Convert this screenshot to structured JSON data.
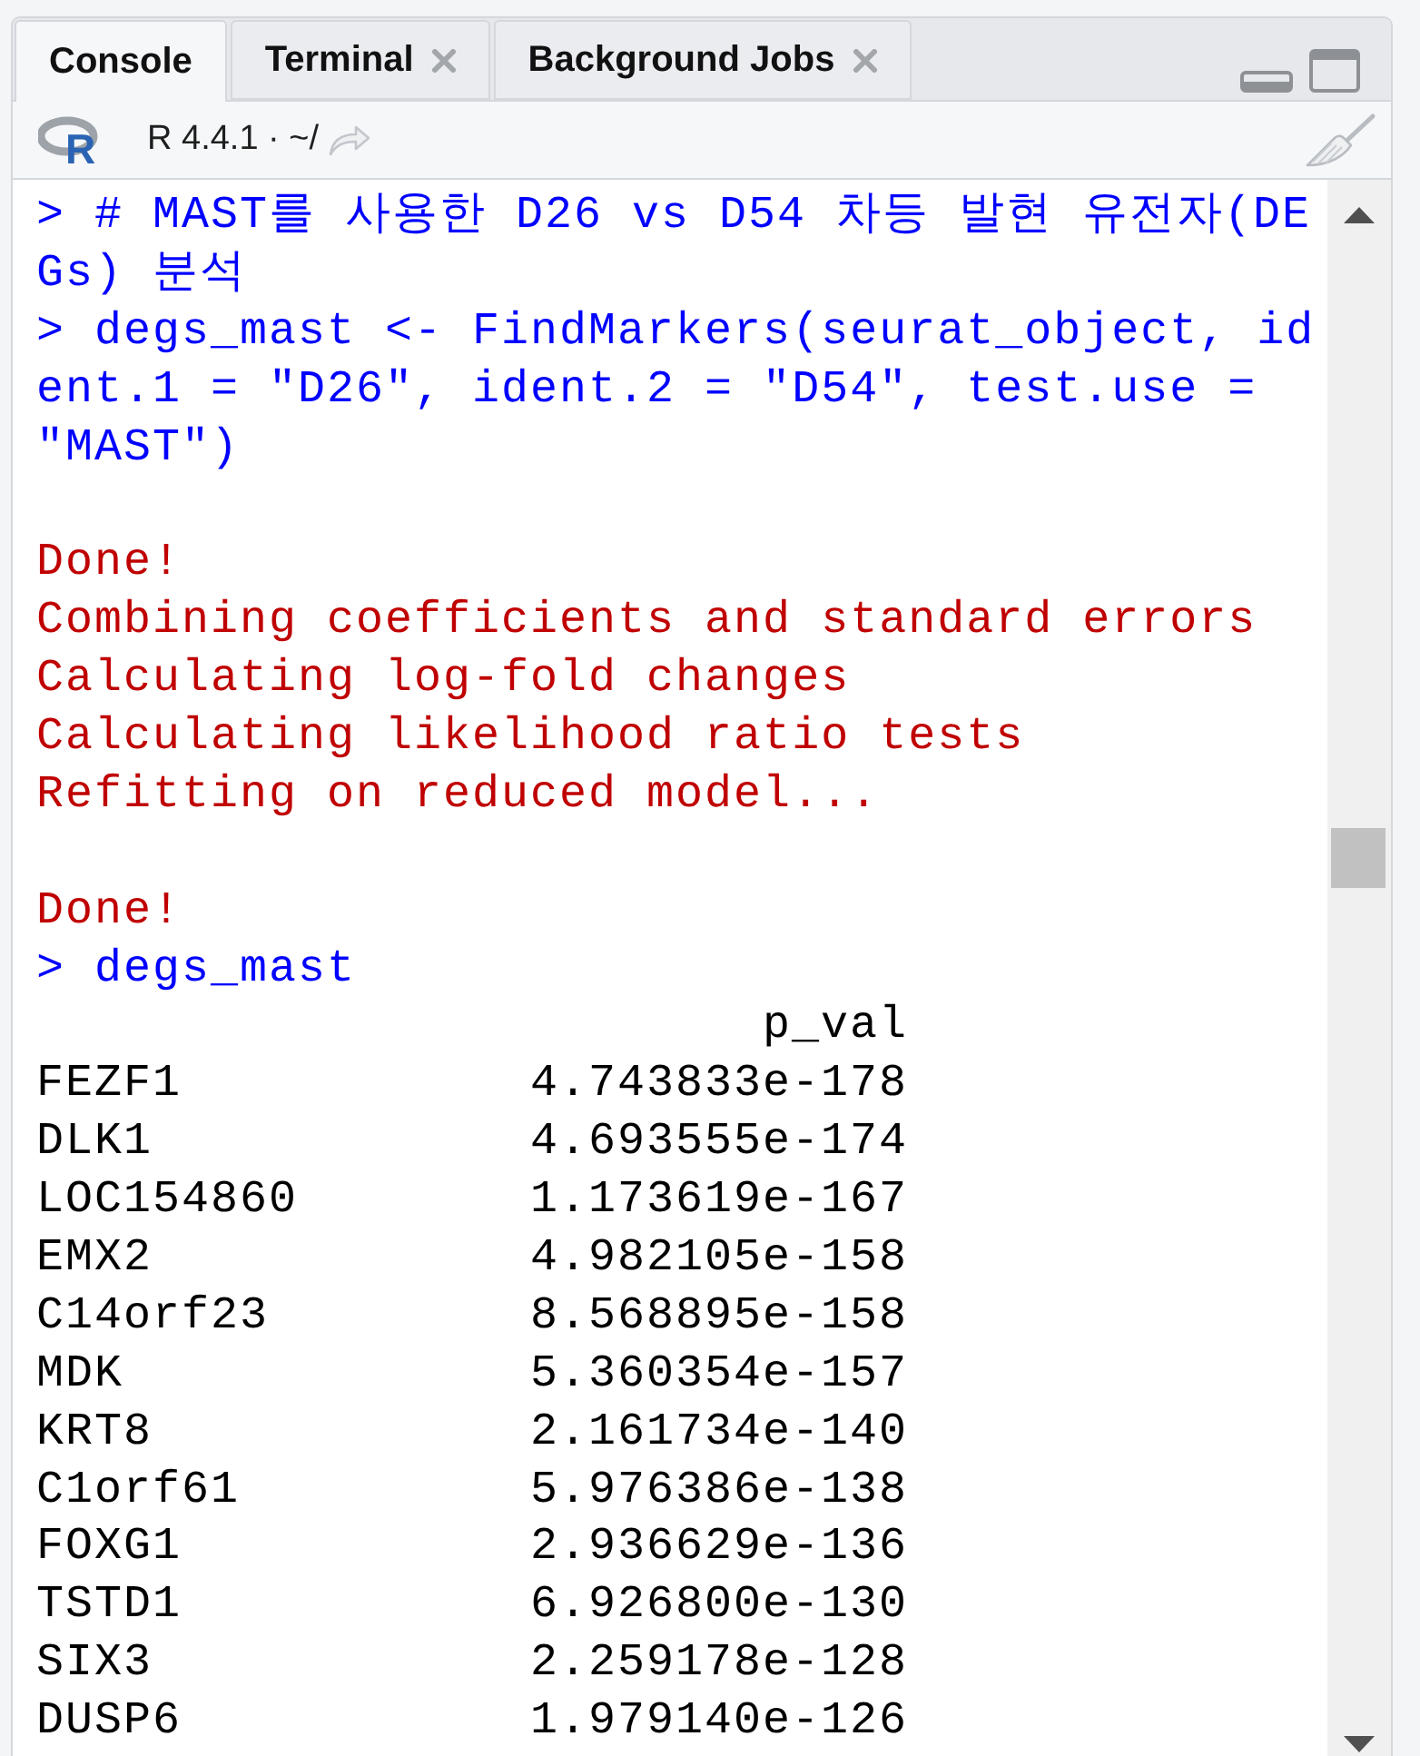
{
  "tabs": [
    {
      "label": "Console",
      "selected": true,
      "closable": false
    },
    {
      "label": "Terminal",
      "selected": false,
      "closable": true
    },
    {
      "label": "Background Jobs",
      "selected": false,
      "closable": true
    }
  ],
  "toolbar": {
    "logo_text": "R",
    "session": "R 4.4.1 · ~/"
  },
  "console": {
    "lines": [
      {
        "kind": "command",
        "text": "> # MAST를 사용한 D26 vs D54 차등 발현 유전자(DE"
      },
      {
        "kind": "command",
        "text": "Gs) 분석"
      },
      {
        "kind": "command",
        "text": "> degs_mast <- FindMarkers(seurat_object, id"
      },
      {
        "kind": "command",
        "text": "ent.1 = \"D26\", ident.2 = \"D54\", test.use ="
      },
      {
        "kind": "command",
        "text": "\"MAST\")"
      },
      {
        "kind": "blank"
      },
      {
        "kind": "message",
        "text": "Done!"
      },
      {
        "kind": "message",
        "text": "Combining coefficients and standard errors"
      },
      {
        "kind": "message",
        "text": "Calculating log-fold changes"
      },
      {
        "kind": "message",
        "text": "Calculating likelihood ratio tests"
      },
      {
        "kind": "message",
        "text": "Refitting on reduced model..."
      },
      {
        "kind": "blank"
      },
      {
        "kind": "message",
        "text": "Done!"
      },
      {
        "kind": "command",
        "text": "> degs_mast"
      }
    ],
    "table": {
      "header": "p_val",
      "rows": [
        {
          "gene": "FEZF1",
          "p_val": "4.743833e-178"
        },
        {
          "gene": "DLK1",
          "p_val": "4.693555e-174"
        },
        {
          "gene": "LOC154860",
          "p_val": "1.173619e-167"
        },
        {
          "gene": "EMX2",
          "p_val": "4.982105e-158"
        },
        {
          "gene": "C14orf23",
          "p_val": "8.568895e-158"
        },
        {
          "gene": "MDK",
          "p_val": "5.360354e-157"
        },
        {
          "gene": "KRT8",
          "p_val": "2.161734e-140"
        },
        {
          "gene": "C1orf61",
          "p_val": "5.976386e-138"
        },
        {
          "gene": "FOXG1",
          "p_val": "2.936629e-136"
        },
        {
          "gene": "TSTD1",
          "p_val": "6.926800e-130"
        },
        {
          "gene": "SIX3",
          "p_val": "2.259178e-128"
        },
        {
          "gene": "DUSP6",
          "p_val": "1.979140e-126"
        }
      ]
    }
  }
}
